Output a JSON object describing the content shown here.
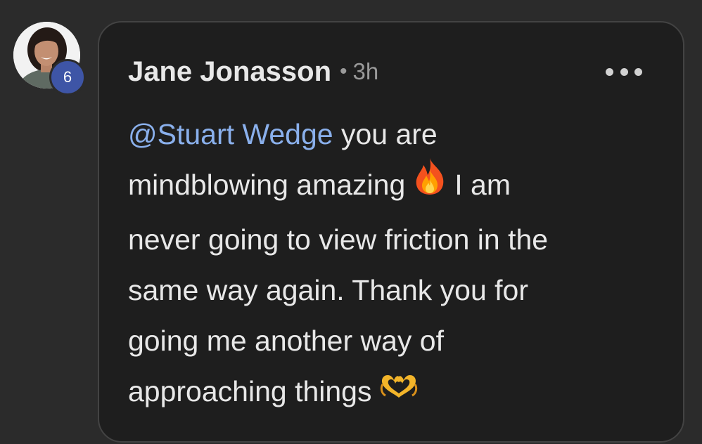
{
  "comment": {
    "author": "Jane Jonasson",
    "separator": "•",
    "time": "3h",
    "badge_count": "6",
    "mention": "@Stuart Wedge",
    "lines": {
      "l1": " you are",
      "l2a": "mindblowing amazing",
      "l2b": "I am",
      "l3": "never going to view friction in the",
      "l4": "same way again. Thank you for",
      "l5": "going me another way of",
      "l6": "approaching things"
    },
    "emojis": {
      "fire": "fire-emoji",
      "heart_hands": "heart-hands-emoji"
    },
    "more_menu_icon": "more-horizontal-icon"
  },
  "colors": {
    "background": "#2b2b2b",
    "card": "#1e1e1e",
    "mention": "#8ab0ec",
    "text": "#e8e8e8",
    "badge": "#3e55a6"
  }
}
